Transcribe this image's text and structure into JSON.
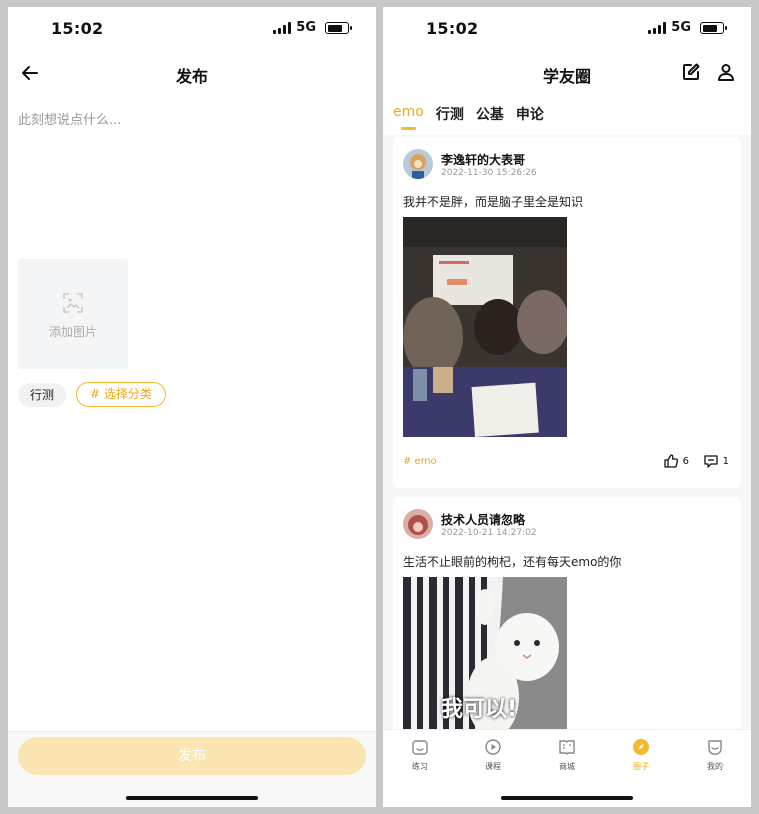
{
  "status": {
    "time": "15:02",
    "network": "5G"
  },
  "publish_screen": {
    "title": "发布",
    "compose_placeholder": "此刻想说点什么...",
    "add_image_label": "添加图片",
    "category_chip": "行测",
    "choose_category": "# 选择分类",
    "publish_button": "发布"
  },
  "feed_screen": {
    "title": "学友圈",
    "tabs": [
      {
        "label": "emo",
        "active": true
      },
      {
        "label": "行测",
        "active": false
      },
      {
        "label": "公基",
        "active": false
      },
      {
        "label": "申论",
        "active": false
      }
    ],
    "posts": [
      {
        "username": "李逸轩的大表哥",
        "date": "2022-11-30 15:26:26",
        "text": "我并不是胖，而是脑子里全是知识",
        "tag": "# emo",
        "likes": "6",
        "comments": "1"
      },
      {
        "username": "技术人员请忽略",
        "date": "2022-10-21 14:27:02",
        "text": "生活不止眼前的枸杞，还有每天emo的你",
        "image_caption": "我可以!"
      }
    ],
    "tabbar": [
      {
        "label": "练习",
        "icon": "home-icon"
      },
      {
        "label": "课程",
        "icon": "play-icon"
      },
      {
        "label": "商城",
        "icon": "book-icon"
      },
      {
        "label": "圈子",
        "icon": "compass-icon",
        "active": true
      },
      {
        "label": "我的",
        "icon": "smile-icon"
      }
    ]
  },
  "colors": {
    "accent": "#f5b82e",
    "accent_text": "#f0a81e",
    "publish_disabled": "#fbe6b3"
  }
}
